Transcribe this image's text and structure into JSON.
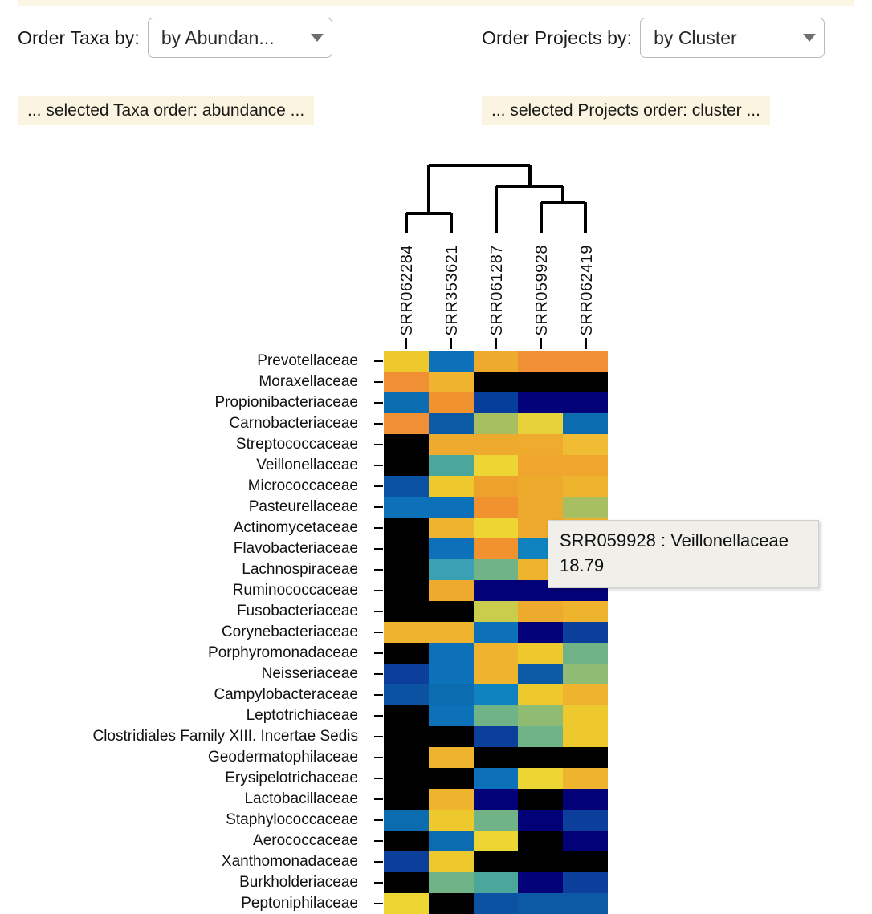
{
  "top_strip_color": "#fbf6e3",
  "controls": {
    "taxa": {
      "label": "Order Taxa by:",
      "selected": "by Abundan...",
      "caret_icon": "chevron-down-icon"
    },
    "projects": {
      "label": "Order Projects by:",
      "selected": "by Cluster",
      "caret_icon": "chevron-down-icon"
    }
  },
  "status": {
    "taxa": "... selected Taxa order: abundance ...",
    "projects": "... selected Projects order: cluster ..."
  },
  "tooltip": {
    "title": "SRR059928 : Veillonellaceae",
    "value": "18.79"
  },
  "chart_data": {
    "type": "heatmap",
    "title": "",
    "xlabel": "",
    "ylabel": "",
    "legend": "none",
    "grid": false,
    "columns": [
      "SRR062284",
      "SRR353621",
      "SRR061287",
      "SRR059928",
      "SRR062419"
    ],
    "rows": [
      "Prevotellaceae",
      "Moraxellaceae",
      "Propionibacteriaceae",
      "Carnobacteriaceae",
      "Streptococcaceae",
      "Veillonellaceae",
      "Micrococcaceae",
      "Pasteurellaceae",
      "Actinomycetaceae",
      "Flavobacteriaceae",
      "Lachnospiraceae",
      "Ruminococcaceae",
      "Fusobacteriaceae",
      "Corynebacteriaceae",
      "Porphyromonadaceae",
      "Neisseriaceae",
      "Campylobacteraceae",
      "Leptotrichiaceae",
      "Clostridiales Family XIII. Incertae Sedis",
      "Geodermatophilaceae",
      "Erysipelotrichaceae",
      "Lactobacillaceae",
      "Staphylococcaceae",
      "Aerococcaceae",
      "Xanthomonadaceae",
      "Burkholderiaceae",
      "Peptoniphilaceae"
    ],
    "cell_colors": [
      [
        "#edc92e",
        "#0c71b9",
        "#eeaa2c",
        "#f08f33",
        "#f08f33"
      ],
      [
        "#f08f33",
        "#eeb42e",
        "#000000",
        "#000000",
        "#000000"
      ],
      [
        "#0c6cb0",
        "#f0932f",
        "#063e9b",
        "#030177",
        "#030177"
      ],
      [
        "#f08f33",
        "#0c5aa6",
        "#a7bf61",
        "#e8d23c",
        "#0c6cb0"
      ],
      [
        "#000000",
        "#eeaa2c",
        "#eeaa2c",
        "#eeab2d",
        "#efbc33"
      ],
      [
        "#000000",
        "#4ba79c",
        "#edd534",
        "#efa52e",
        "#efa52e"
      ],
      [
        "#0c52a2",
        "#edc92e",
        "#eea22c",
        "#eeaa2c",
        "#eeb42e"
      ],
      [
        "#0c71b9",
        "#0c71b9",
        "#f0932f",
        "#eeaa2c",
        "#a7bf61"
      ],
      [
        "#000000",
        "#eeb42e",
        "#edd534",
        "#eeaa2c",
        "#eeb42e"
      ],
      [
        "#000000",
        "#0c71b9",
        "#f0932f",
        "#0f83c0",
        "#4ba79c"
      ],
      [
        "#000000",
        "#3ca0b4",
        "#6fb386",
        "#eeb42e",
        "#eeb42e"
      ],
      [
        "#000000",
        "#eeaa2c",
        "#030177",
        "#030177",
        "#030177"
      ],
      [
        "#000000",
        "#000000",
        "#c9cd4b",
        "#eeaa2c",
        "#eeb42e"
      ],
      [
        "#eeb42e",
        "#eeb42e",
        "#0c71b9",
        "#030177",
        "#0c3f9b"
      ],
      [
        "#000000",
        "#0c71b9",
        "#eeb42e",
        "#edc92e",
        "#6fb386"
      ],
      [
        "#0c3f9b",
        "#0c71b9",
        "#eeb42e",
        "#0c5aa6",
        "#8fbb72"
      ],
      [
        "#0c52a2",
        "#0c6cb0",
        "#0f83c0",
        "#edc92e",
        "#eeb42e"
      ],
      [
        "#000000",
        "#0c71b9",
        "#6fb386",
        "#8fbb72",
        "#edc92e"
      ],
      [
        "#000000",
        "#000000",
        "#0c3f9b",
        "#6fb386",
        "#edc92e"
      ],
      [
        "#000000",
        "#eeb42e",
        "#000000",
        "#000000",
        "#000000"
      ],
      [
        "#000000",
        "#000000",
        "#0c71b9",
        "#edd534",
        "#eeb42e"
      ],
      [
        "#000000",
        "#eeb42e",
        "#030177",
        "#000000",
        "#030177"
      ],
      [
        "#0c6cb0",
        "#edc92e",
        "#6fb386",
        "#030177",
        "#0c3f9b"
      ],
      [
        "#000000",
        "#0c6cb0",
        "#edd534",
        "#000000",
        "#030177"
      ],
      [
        "#0c3f9b",
        "#edc92e",
        "#000000",
        "#000000",
        "#000000"
      ],
      [
        "#000000",
        "#6fb386",
        "#4ba79c",
        "#030177",
        "#0c3f9b"
      ],
      [
        "#edd534",
        "#000000",
        "#0c52a2",
        "#0c5aa6",
        "#0c5aa6"
      ]
    ],
    "highlighted_cell": {
      "row": "Veillonellaceae",
      "column": "SRR059928",
      "value": 18.79
    }
  },
  "dendrogram": {
    "leaves": [
      "SRR062284",
      "SRR353621",
      "SRR061287",
      "SRR059928",
      "SRR062419"
    ],
    "description": "((SRR062284,SRR353621),(SRR061287,(SRR059928,SRR062419)))"
  }
}
